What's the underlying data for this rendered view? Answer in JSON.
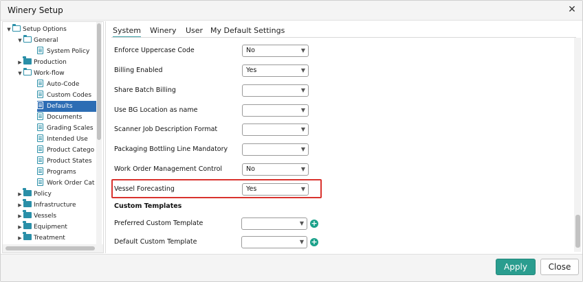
{
  "window": {
    "title": "Winery Setup",
    "close_glyph": "✕"
  },
  "tree": {
    "items": [
      {
        "label": "Setup Options",
        "level": 0,
        "kind": "folder-open",
        "arrow": "▼"
      },
      {
        "label": "General",
        "level": 1,
        "kind": "folder-open",
        "arrow": "▼"
      },
      {
        "label": "System Policy",
        "level": 2,
        "kind": "doc",
        "arrow": ""
      },
      {
        "label": "Production",
        "level": 1,
        "kind": "folder-closed",
        "arrow": "▶"
      },
      {
        "label": "Work-flow",
        "level": 1,
        "kind": "folder-open",
        "arrow": "▼"
      },
      {
        "label": "Auto-Code",
        "level": 2,
        "kind": "doc",
        "arrow": ""
      },
      {
        "label": "Custom Codes",
        "level": 2,
        "kind": "doc",
        "arrow": ""
      },
      {
        "label": "Defaults",
        "level": 2,
        "kind": "doc",
        "arrow": "",
        "selected": true
      },
      {
        "label": "Documents",
        "level": 2,
        "kind": "doc",
        "arrow": ""
      },
      {
        "label": "Grading Scales",
        "level": 2,
        "kind": "doc",
        "arrow": ""
      },
      {
        "label": "Intended Use",
        "level": 2,
        "kind": "doc",
        "arrow": ""
      },
      {
        "label": "Product Catego",
        "level": 2,
        "kind": "doc",
        "arrow": ""
      },
      {
        "label": "Product States",
        "level": 2,
        "kind": "doc",
        "arrow": ""
      },
      {
        "label": "Programs",
        "level": 2,
        "kind": "doc",
        "arrow": ""
      },
      {
        "label": "Work Order Cat",
        "level": 2,
        "kind": "doc",
        "arrow": ""
      },
      {
        "label": "Policy",
        "level": 1,
        "kind": "folder-closed",
        "arrow": "▶"
      },
      {
        "label": "Infrastructure",
        "level": 1,
        "kind": "folder-closed",
        "arrow": "▶"
      },
      {
        "label": "Vessels",
        "level": 1,
        "kind": "folder-closed",
        "arrow": "▶"
      },
      {
        "label": "Equipment",
        "level": 1,
        "kind": "folder-closed",
        "arrow": "▶"
      },
      {
        "label": "Treatment",
        "level": 1,
        "kind": "folder-closed",
        "arrow": "▶"
      }
    ]
  },
  "tabs": [
    {
      "label": "System",
      "active": true
    },
    {
      "label": "Winery",
      "active": false
    },
    {
      "label": "User",
      "active": false
    },
    {
      "label": "My Default Settings",
      "active": false
    }
  ],
  "settings": [
    {
      "label": "Enforce Uppercase Code",
      "value": "No"
    },
    {
      "label": "Billing Enabled",
      "value": "Yes"
    },
    {
      "label": "Share Batch Billing",
      "value": ""
    },
    {
      "label": "Use BG Location as name",
      "value": ""
    },
    {
      "label": "Scanner Job Description Format",
      "value": ""
    },
    {
      "label": "Packaging Bottling Line Mandatory",
      "value": ""
    },
    {
      "label": "Work Order Management Control",
      "value": "No"
    },
    {
      "label": "Vessel Forecasting",
      "value": "Yes",
      "highlighted": true
    }
  ],
  "custom_templates": {
    "title": "Custom Templates",
    "rows": [
      {
        "label": "Preferred Custom Template",
        "value": ""
      },
      {
        "label": "Default Custom Template",
        "value": ""
      }
    ]
  },
  "icons": {
    "caret": "▼",
    "plus": "+"
  },
  "colors": {
    "accent": "#2a9d8f",
    "selection": "#2d6db4",
    "highlight": "#d9322d",
    "folder": "#2a8fa8"
  },
  "footer": {
    "apply_label": "Apply",
    "close_label": "Close"
  }
}
